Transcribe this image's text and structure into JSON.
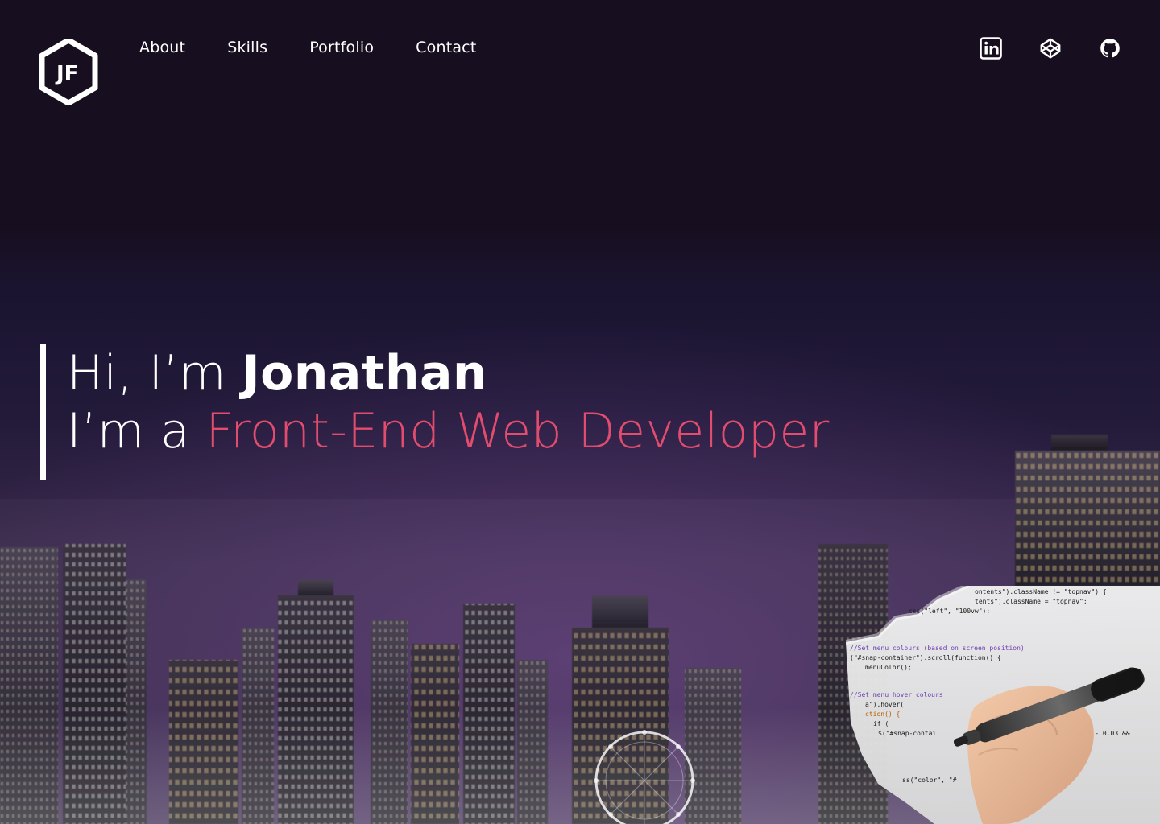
{
  "nav": {
    "items": [
      {
        "label": "About"
      },
      {
        "label": "Skills"
      },
      {
        "label": "Portfolio"
      },
      {
        "label": "Contact"
      }
    ]
  },
  "logo": {
    "text": "JF"
  },
  "social": {
    "icons": [
      {
        "name": "linkedin-icon"
      },
      {
        "name": "codepen-icon"
      },
      {
        "name": "github-icon"
      }
    ]
  },
  "hero": {
    "greeting_prefix": "Hi, I’m ",
    "name": "Jonathan",
    "role_prefix": "I’m a ",
    "role": "Front-End Web Developer",
    "accent_color": "#e24c6e"
  },
  "code_snippet": {
    "lines": [
      "ontents\").className != \"topnav\") {",
      "tents\").className = \"topnav\";",
      "css(\"left\", \"100vw\");",
      "//Set menu colours (based on screen position)",
      "(\"#snap-container\").scroll(function() {",
      "menuColor();",
      "//Set menu hover colours",
      "a\").hover(",
      "ction() {",
      "if (",
      "$(\"#snap-contai",
      "> 1 - 0.03 &&",
      "ss(\"color\", \"#"
    ]
  }
}
